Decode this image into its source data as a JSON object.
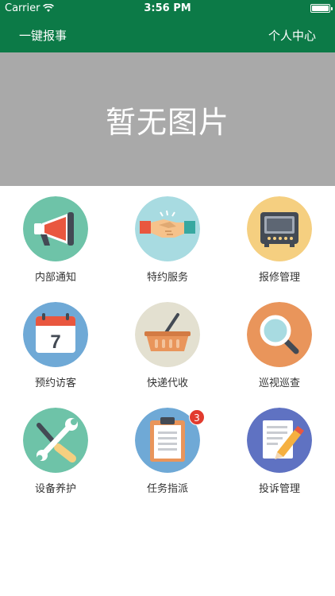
{
  "status_bar": {
    "carrier": "Carrier",
    "time": "3:56 PM",
    "wifi_icon": "wifi-icon",
    "battery_icon": "battery-icon"
  },
  "nav": {
    "left_title": "一键报事",
    "right_link": "个人中心",
    "color": "#0c7a47"
  },
  "banner": {
    "placeholder_text": "暂无图片",
    "color": "#a9a9a9"
  },
  "menu": {
    "items": [
      {
        "label": "内部通知",
        "icon": "megaphone-icon",
        "color": "#6ec3a8"
      },
      {
        "label": "特约服务",
        "icon": "handshake-icon",
        "color": "#a8dbe1"
      },
      {
        "label": "报修管理",
        "icon": "monitor-icon",
        "color": "#f5cf80"
      },
      {
        "label": "预约访客",
        "icon": "calendar-icon",
        "color": "#6fa9d6"
      },
      {
        "label": "快递代收",
        "icon": "basket-icon",
        "color": "#e3e0d0"
      },
      {
        "label": "巡视巡查",
        "icon": "magnifier-icon",
        "color": "#e9955b"
      },
      {
        "label": "设备养护",
        "icon": "tools-icon",
        "color": "#6ec3a8"
      },
      {
        "label": "任务指派",
        "icon": "clipboard-icon",
        "color": "#6fa9d6",
        "badge": "3"
      },
      {
        "label": "投诉管理",
        "icon": "document-pen-icon",
        "color": "#5f72c2"
      }
    ],
    "calendar_day": "7"
  }
}
